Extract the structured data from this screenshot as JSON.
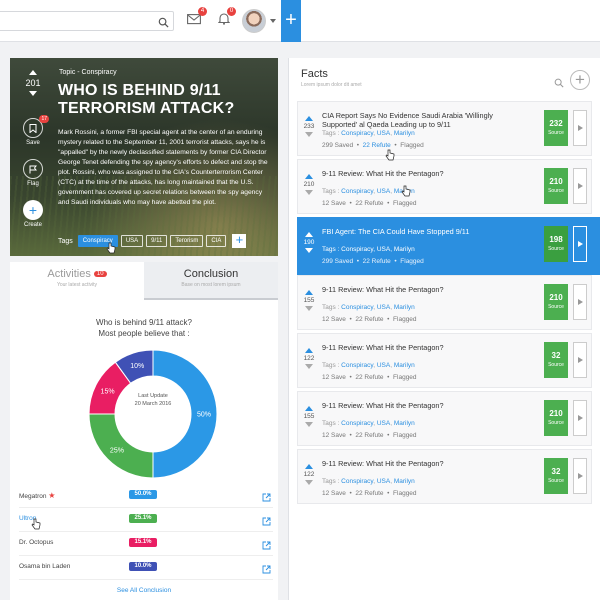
{
  "topbar": {
    "search_placeholder": "",
    "messages_badge": "4",
    "notifications_badge": "0"
  },
  "hero": {
    "votes": "201",
    "topic": "Topic - Conspiracy",
    "title": "WHO IS BEHIND 9/11 TERRORISM ATTACK?",
    "description": "Mark Rossini, a former FBI special agent at the center of an enduring mystery related to the September 11, 2001 terrorist attacks, says he is \"appalled\" by the newly declassified statements by former CIA Director George Tenet defending the spy agency's efforts to defect and stop the plot. Rossini, who was assigned to the CIA's Counterterrorism Center (CTC) at the time of the attacks, has long maintained that the U.S. government has covered up secret relations between the spy agency and Saudi individuals who may have abetted the plot.",
    "save_label": "Save",
    "save_badge": "17",
    "flag_label": "Flag",
    "create_label": "Create",
    "tags_label": "Tags",
    "tags": [
      "Conspiracy",
      "USA",
      "9/11",
      "Terorism",
      "CIA"
    ]
  },
  "tabs": {
    "activities_title": "Activities",
    "activities_badge": "10",
    "activities_sub": "Your latest activity",
    "conclusion_title": "Conclusion",
    "conclusion_sub": "Base on most lorem ipsum"
  },
  "conclusion": {
    "question": "Who is behind 9/11 attack?",
    "subtitle": "Most people believe that :",
    "center_line1": "Last Update",
    "center_line2": "20 March 2016",
    "see_all": "See All Conclusion"
  },
  "chart_data": {
    "type": "pie",
    "donut": true,
    "series": [
      {
        "name": "Megatron",
        "value": 50,
        "label": "50%",
        "pill": "50.0%",
        "color": "#2b98e6"
      },
      {
        "name": "Ultron",
        "value": 25,
        "label": "25%",
        "pill": "25.1%",
        "color": "#4caf50"
      },
      {
        "name": "Dr. Octopus",
        "value": 15,
        "label": "15%",
        "pill": "15.1%",
        "color": "#e91e63"
      },
      {
        "name": "Osama bin Laden",
        "value": 10,
        "label": "10%",
        "pill": "10.0%",
        "color": "#3f51b5"
      }
    ]
  },
  "facts": {
    "title": "Facts",
    "subtitle": "Lorem ipsum dolor dit amet",
    "tags_prefix": "Tags :",
    "source_label": "Source",
    "items": [
      {
        "votes": "233",
        "title": "CIA Report Says No Evidence Saudi Arabia 'Willingly Supported' al Qaeda Leading up to 9/11",
        "tags": [
          "Conspiracy",
          "USA",
          "Marilyn"
        ],
        "saves": "299 Saved",
        "refute": "22 Refute",
        "flagged": "Flagged",
        "score": "232"
      },
      {
        "votes": "210",
        "title": "9-11 Review: What Hit the Pentagon?",
        "tags": [
          "Conspiracy",
          "USA",
          "Marilyn"
        ],
        "saves": "12 Save",
        "refute": "22 Refute",
        "flagged": "Flagged",
        "score": "210"
      },
      {
        "votes": "190",
        "title": "FBI Agent: The CIA Could Have  Stopped 9/11",
        "tags": [
          "Conspiracy",
          "USA",
          "Marilyn"
        ],
        "saves": "299 Saved",
        "refute": "22 Refute",
        "flagged": "Flagged",
        "score": "198"
      },
      {
        "votes": "155",
        "title": "9-11 Review: What Hit the Pentagon?",
        "tags": [
          "Conspiracy",
          "USA",
          "Marilyn"
        ],
        "saves": "12 Save",
        "refute": "22 Refute",
        "flagged": "Flagged",
        "score": "210"
      },
      {
        "votes": "122",
        "title": "9-11 Review: What Hit the Pentagon?",
        "tags": [
          "Conspiracy",
          "USA",
          "Marilyn"
        ],
        "saves": "12 Save",
        "refute": "22 Refute",
        "flagged": "Flagged",
        "score": "32"
      },
      {
        "votes": "155",
        "title": "9-11 Review: What Hit the Pentagon?",
        "tags": [
          "Conspiracy",
          "USA",
          "Marilyn"
        ],
        "saves": "12 Save",
        "refute": "22 Refute",
        "flagged": "Flagged",
        "score": "210"
      },
      {
        "votes": "122",
        "title": "9-11 Review: What Hit the Pentagon?",
        "tags": [
          "Conspiracy",
          "USA",
          "Marilyn"
        ],
        "saves": "12 Save",
        "refute": "22 Refute",
        "flagged": "Flagged",
        "score": "32"
      }
    ]
  },
  "colors": {
    "accent": "#2b8fe0",
    "score_green": "#4caf50",
    "badge_red": "#e8423f"
  }
}
